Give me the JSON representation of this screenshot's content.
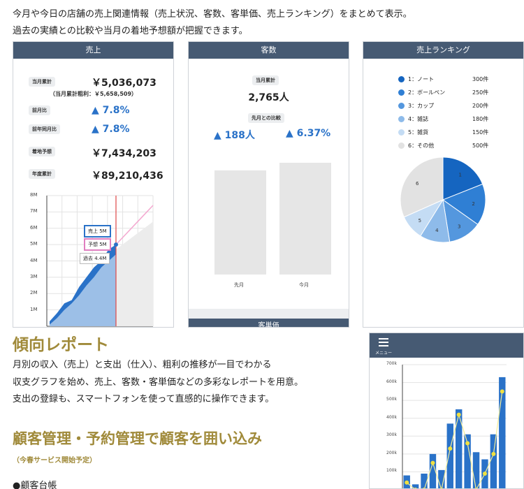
{
  "intro": {
    "line1": "今月や今日の店舗の売上関連情報（売上状況、客数、客単価、売上ランキング）をまとめて表示。",
    "line2": "過去の実績との比較や当月の着地予想額が把握できます。"
  },
  "sales_panel": {
    "title": "売上",
    "rows": [
      {
        "label": "当月累計",
        "value": "￥5,036,073"
      },
      {
        "label": "前月比",
        "value": "▲ 7.8%"
      },
      {
        "label": "前年同月比",
        "value": "▲ 7.8%"
      },
      {
        "label": "着地予想",
        "value": "￥7,434,203"
      },
      {
        "label": "年度累計",
        "value": "￥89,210,436"
      }
    ],
    "gross_profit_note": "（当月累計粗利：￥5,658,509）",
    "tooltips": {
      "sales": "売上 5M",
      "forecast": "予想 5M",
      "past": "過去 4.4M"
    },
    "accent_color": "#2a72c8"
  },
  "customers_panel": {
    "title": "客数",
    "current_label": "当月累計",
    "current_value": "2,765人",
    "compare_label": "先月との比較",
    "diff_count": "▲ 188人",
    "diff_percent": "▲ 6.37%",
    "next_section_title": "客単価"
  },
  "ranking_panel": {
    "title": "売上ランキング",
    "legend": [
      {
        "label": "1：ノート",
        "count": "300件",
        "color": "#1565c0"
      },
      {
        "label": "2：ボールペン",
        "count": "250件",
        "color": "#2f7fd4"
      },
      {
        "label": "3：カップ",
        "count": "200件",
        "color": "#5497de"
      },
      {
        "label": "4：雑誌",
        "count": "180件",
        "color": "#8ebbea"
      },
      {
        "label": "5：雑貨",
        "count": "150件",
        "color": "#c4dcf4"
      },
      {
        "label": "6：その他",
        "count": "500件",
        "color": "#e2e2e2"
      }
    ]
  },
  "trend_report": {
    "heading": "傾向レポート",
    "lines": [
      "月別の収入（売上）と支出（仕入）、粗利の推移が一目でわかる",
      "収支グラフを始め、売上、客数・客単価などの多彩なレポートを用意。",
      "支出の登録も、スマートフォンを使って直感的に操作できます。"
    ]
  },
  "customer_mgmt": {
    "heading": "顧客管理・予約管理で顧客を囲い込み",
    "note": "（今春サービス開始予定）",
    "item1": "●顧客台帳"
  },
  "phone": {
    "menu_label": "メニュー",
    "menu_icon": "hamburger-icon"
  },
  "chart_data": [
    {
      "type": "area",
      "title": "",
      "yticks": [
        "8M",
        "7M",
        "6M",
        "5M",
        "4M",
        "3M",
        "2M",
        "1M"
      ],
      "ylim": [
        0,
        8
      ],
      "unit": "M",
      "series": [
        {
          "name": "売上",
          "color": "#2a72c8",
          "values": [
            0.3,
            0.8,
            1.4,
            1.6,
            2.4,
            3.0,
            3.6,
            4.0,
            4.7,
            5.0
          ]
        },
        {
          "name": "過去",
          "color": "#a9c8ea",
          "values": [
            0.1,
            0.5,
            1.0,
            1.4,
            1.9,
            2.5,
            3.0,
            3.6,
            4.0,
            4.4
          ]
        },
        {
          "name": "予想",
          "color": "#f4a8d0",
          "values": [
            5.0,
            5.6,
            6.2,
            6.8,
            7.4
          ]
        }
      ]
    },
    {
      "type": "bar",
      "categories": [
        "先月",
        "今月"
      ],
      "values": [
        2577,
        2765
      ]
    },
    {
      "type": "pie",
      "categories": [
        "1",
        "2",
        "3",
        "4",
        "5",
        "6"
      ],
      "values": [
        300,
        250,
        200,
        180,
        150,
        500
      ]
    },
    {
      "type": "bar",
      "yticks": [
        "700k",
        "600k",
        "500k",
        "400k",
        "300k",
        "200k",
        "100k"
      ],
      "ylim": [
        0,
        700
      ],
      "series": [
        {
          "color": "#2a72c8",
          "values": [
            80,
            30,
            90,
            200,
            110,
            370,
            450,
            310,
            210,
            170,
            310,
            630
          ]
        },
        {
          "color": "#f0e040",
          "values": [
            40,
            0,
            0,
            150,
            0,
            230,
            420,
            260,
            0,
            90,
            200,
            550
          ]
        }
      ]
    }
  ]
}
